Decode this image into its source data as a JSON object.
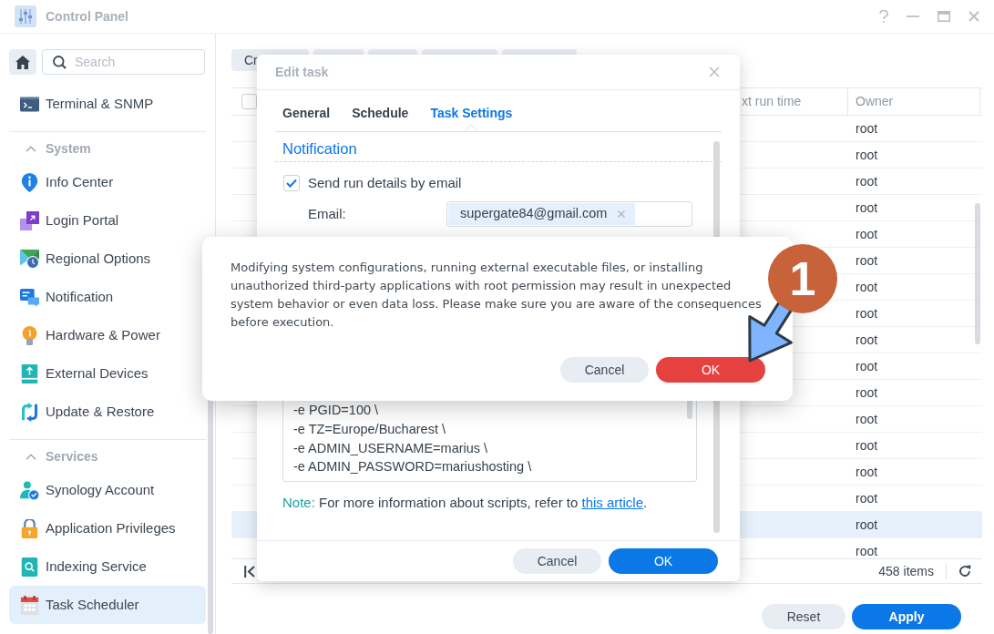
{
  "window": {
    "title": "Control Panel"
  },
  "sidebar": {
    "search": {
      "placeholder": "Search"
    },
    "items": [
      {
        "label": "Terminal & SNMP",
        "selected": false
      }
    ],
    "groups": [
      {
        "title": "System",
        "expanded": true,
        "items": [
          {
            "label": "Info Center",
            "selected": false
          },
          {
            "label": "Login Portal",
            "selected": false
          },
          {
            "label": "Regional Options",
            "selected": false
          },
          {
            "label": "Notification",
            "selected": false
          },
          {
            "label": "Hardware & Power",
            "selected": false
          },
          {
            "label": "External Devices",
            "selected": false
          },
          {
            "label": "Update & Restore",
            "selected": false
          }
        ]
      },
      {
        "title": "Services",
        "expanded": true,
        "items": [
          {
            "label": "Synology Account",
            "selected": false
          },
          {
            "label": "Application Privileges",
            "selected": false
          },
          {
            "label": "Indexing Service",
            "selected": false
          },
          {
            "label": "Task Scheduler",
            "selected": true
          }
        ]
      }
    ]
  },
  "toolbar": {
    "buttons": [
      {
        "kind": "labeled",
        "label": "Cr"
      },
      {
        "kind": "covered"
      },
      {
        "kind": "covered"
      },
      {
        "kind": "covered"
      },
      {
        "kind": "covered"
      }
    ]
  },
  "table": {
    "header_checkbox": {
      "checked": false
    },
    "columns": [
      "xt run time",
      "Owner"
    ],
    "rows": [
      {
        "owner": "root",
        "selected": false
      },
      {
        "owner": "root",
        "selected": false
      },
      {
        "owner": "root",
        "selected": false
      },
      {
        "owner": "root",
        "selected": false
      },
      {
        "owner": "root",
        "selected": false
      },
      {
        "owner": "root",
        "selected": false
      },
      {
        "owner": "root",
        "selected": false
      },
      {
        "owner": "root",
        "selected": false
      },
      {
        "owner": "root",
        "selected": false
      },
      {
        "owner": "root",
        "selected": false
      },
      {
        "owner": "root",
        "selected": false
      },
      {
        "owner": "root",
        "selected": false
      },
      {
        "owner": "root",
        "selected": false
      },
      {
        "owner": "root",
        "selected": false
      },
      {
        "owner": "root",
        "selected": false
      },
      {
        "owner": "root",
        "selected": true
      },
      {
        "owner": "root",
        "selected": false
      }
    ],
    "footer": {
      "count": "458 items"
    }
  },
  "actions": [
    {
      "label": "Reset",
      "kind": "secondary"
    },
    {
      "label": "Apply",
      "kind": "primary"
    }
  ],
  "edit_task": {
    "title": "Edit task",
    "tabs": [
      {
        "label": "General",
        "selected": false
      },
      {
        "label": "Schedule",
        "selected": false
      },
      {
        "label": "Task Settings",
        "selected": true
      }
    ],
    "section_title": "Notification",
    "send_email": {
      "label": "Send run details by email",
      "checked": true
    },
    "email": {
      "label": "Email:",
      "chips": [
        "supergate84@gmail.com"
      ]
    },
    "script_lines": [
      "-e PGID=100 \\",
      "-e TZ=Europe/Bucharest \\",
      "-e ADMIN_USERNAME=marius \\",
      "-e ADMIN_PASSWORD=mariushosting \\"
    ],
    "note": {
      "label": "Note:",
      "text": "For more information about scripts, refer to",
      "link": "this article",
      "end": "."
    },
    "buttons": [
      {
        "label": "Cancel",
        "kind": "secondary"
      },
      {
        "label": "OK",
        "kind": "primary"
      }
    ]
  },
  "alert": {
    "message": "Modifying system configurations, running external executable files, or installing unauthorized third-party applications with root permission may result in unexpected system behavior or even data loss. Please make sure you are aware of the consequences before execution.",
    "buttons": [
      {
        "label": "Cancel",
        "kind": "secondary"
      },
      {
        "label": "OK",
        "kind": "danger"
      }
    ]
  },
  "annotation": {
    "label": "1"
  }
}
